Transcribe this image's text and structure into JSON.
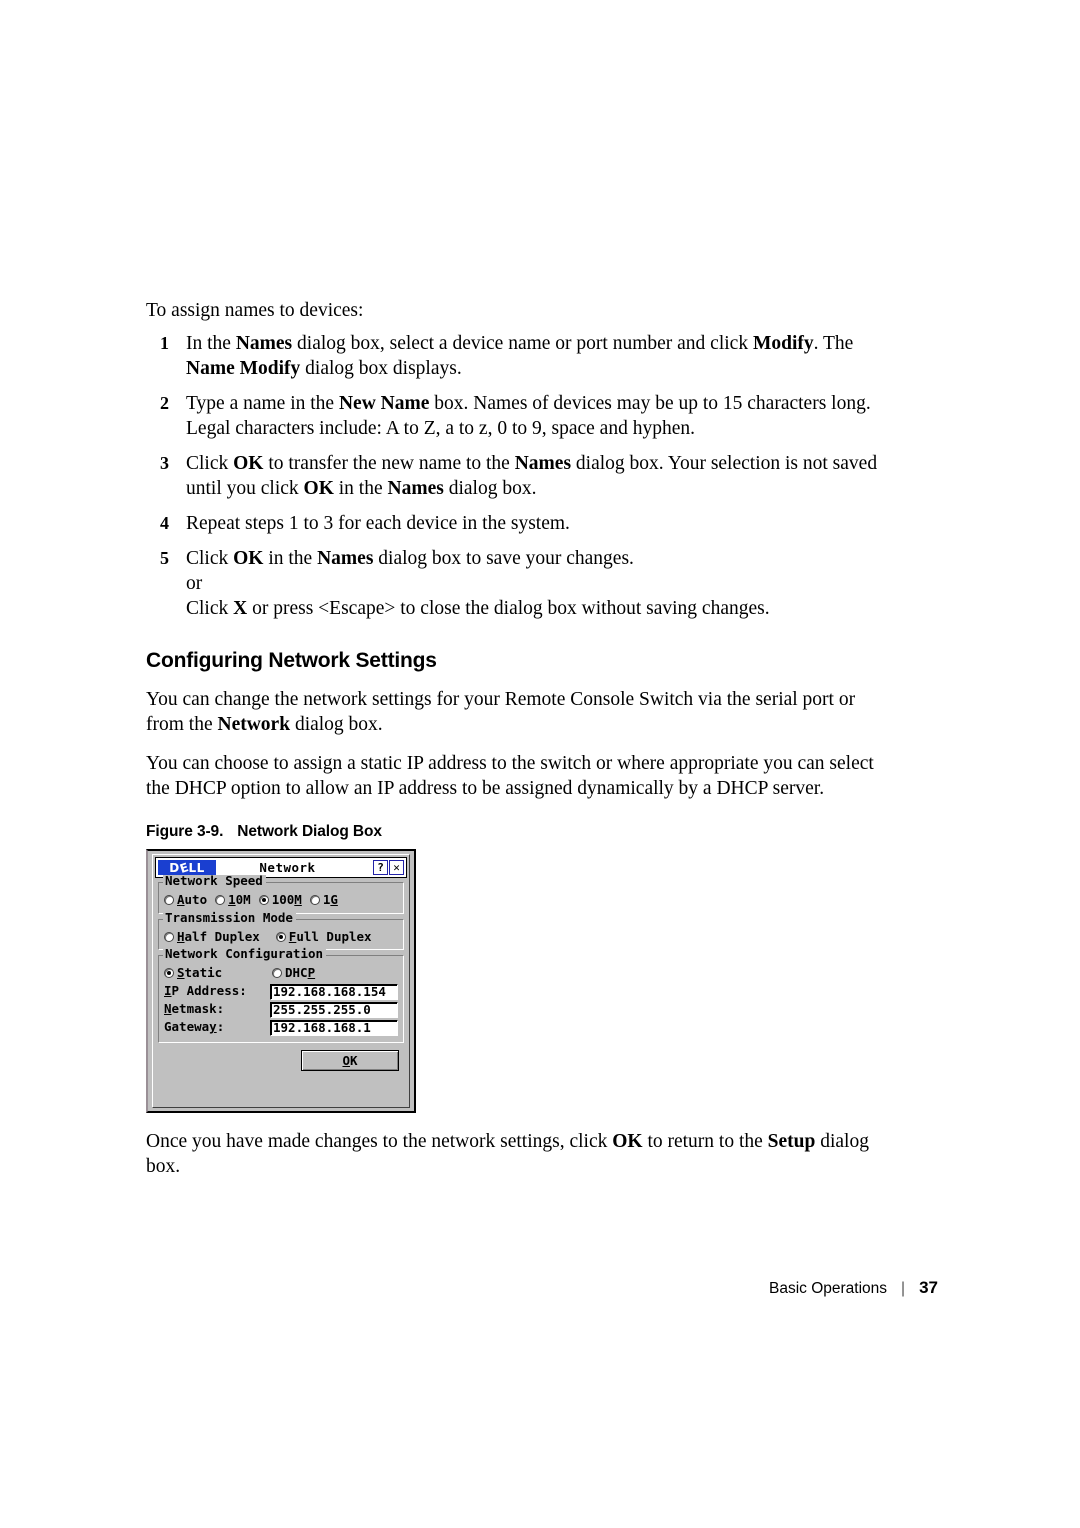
{
  "body": {
    "lead": "To assign names to devices:",
    "steps": [
      {
        "num": "1",
        "html": "In the <b>Names</b> dialog box, select a device name or port number and click <b>Modify</b>. The <b>Name Modify</b> dialog box displays."
      },
      {
        "num": "2",
        "html": "Type a name in the <b>New Name</b> box. Names of devices may be up to 15 characters long. Legal characters include: A to Z, a to z, 0 to 9, space and hyphen."
      },
      {
        "num": "3",
        "html": "Click <b>OK</b> to transfer the new name to the <b>Names</b> dialog box. Your selection is not saved until you click <b>OK</b> in the <b>Names</b> dialog box."
      },
      {
        "num": "4",
        "html": "Repeat steps 1 to 3 for each device in the system."
      },
      {
        "num": "5",
        "html": "Click <b>OK</b> in the <b>Names</b> dialog box to save your changes.<span class=\"sub-or\">or</span><span class=\"sub-or\">Click <b>X</b> or press &lt;Escape&gt; to close the dialog box without saving changes.</span>"
      }
    ],
    "section_title": "Configuring Network Settings",
    "para1_html": "You can change the network settings for your Remote Console Switch via the serial port or from the <b>Network</b> dialog box.",
    "para2_html": "You can choose to assign a static IP address to the switch or where appropriate you can select the DHCP option to allow an IP address to be assigned dynamically by a DHCP server.",
    "figure_number": "Figure 3-9.",
    "figure_title": "Network Dialog Box",
    "closing_html": "Once you have made changes to the network settings, click <b>OK</b> to return to the <b>Setup</b> dialog box."
  },
  "dialog": {
    "logo_text": "DELL",
    "logo_color": "#1a3fd0",
    "title": "Network",
    "help_button": "?",
    "close_button": "✕",
    "groups": {
      "network_speed": {
        "legend": "Network Speed",
        "options": [
          {
            "label": "Auto",
            "pre": "",
            "accel": "A",
            "post": "uto",
            "selected": false
          },
          {
            "label": "10M",
            "pre": "",
            "accel": "1",
            "post": "0M",
            "selected": false
          },
          {
            "label": "100M",
            "pre": "100",
            "accel": "M",
            "post": "",
            "selected": true
          },
          {
            "label": "1G",
            "pre": "1",
            "accel": "G",
            "post": "",
            "selected": false
          }
        ]
      },
      "transmission_mode": {
        "legend": "Transmission Mode",
        "options": [
          {
            "label": "Half Duplex",
            "pre": "",
            "accel": "H",
            "post": "alf Duplex",
            "selected": false
          },
          {
            "label": "Full Duplex",
            "pre": "",
            "accel": "F",
            "post": "ull Duplex",
            "selected": true
          }
        ]
      },
      "network_configuration": {
        "legend": "Network Configuration",
        "options": [
          {
            "label": "Static",
            "pre": "",
            "accel": "S",
            "post": "tatic",
            "selected": true
          },
          {
            "label": "DHCP",
            "pre": "DHC",
            "accel": "P",
            "post": "",
            "selected": false
          }
        ],
        "fields": [
          {
            "label_pre": "",
            "label_accel": "I",
            "label_post": "P Address:",
            "value": "192.168.168.154"
          },
          {
            "label_pre": "",
            "label_accel": "N",
            "label_post": "etmask:",
            "value": "255.255.255.0"
          },
          {
            "label_pre": "Gatewa",
            "label_accel": "y",
            "label_post": ":",
            "value": "192.168.168.1"
          }
        ]
      }
    },
    "ok_button": {
      "pre": "",
      "accel": "O",
      "post": "K"
    }
  },
  "footer": {
    "section": "Basic Operations",
    "separator": "|",
    "page_number": "37"
  }
}
